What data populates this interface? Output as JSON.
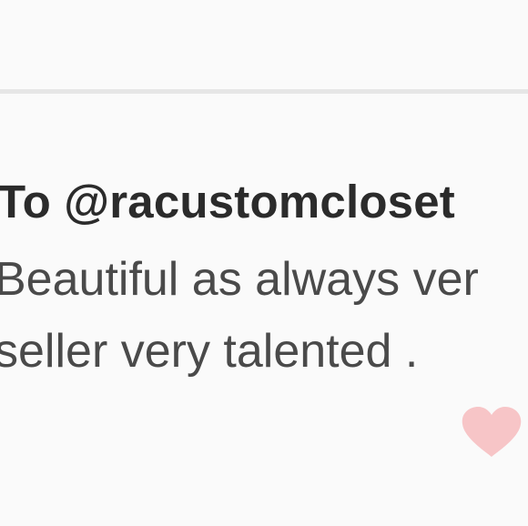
{
  "comment": {
    "recipient_line": "To @racustomcloset",
    "message_lines": [
      "Beautiful as always ver",
      "seller very talented ."
    ]
  },
  "colors": {
    "background": "#fafafa",
    "divider": "#e6e6e6",
    "recipient_text": "#2b2b2b",
    "message_text": "#4a4a4a",
    "heart": "#f7c5c7"
  },
  "icons": {
    "like": "heart-icon"
  }
}
